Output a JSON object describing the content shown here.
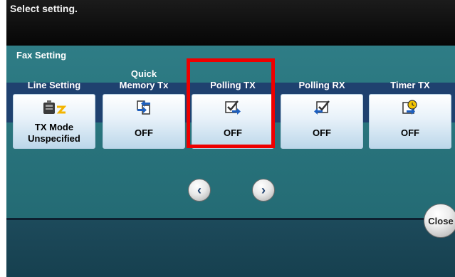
{
  "prompt": "Select setting.",
  "group_title": "Fax Setting",
  "settings": [
    {
      "label": "Line Setting",
      "value": "TX Mode\nUnspecified",
      "icon": "line-setting-icon"
    },
    {
      "label": "Quick\nMemory Tx",
      "value": "OFF",
      "icon": "quick-memory-icon"
    },
    {
      "label": "Polling TX",
      "value": "OFF",
      "icon": "polling-tx-icon",
      "highlighted": true
    },
    {
      "label": "Polling RX",
      "value": "OFF",
      "icon": "polling-rx-icon"
    },
    {
      "label": "Timer TX",
      "value": "OFF",
      "icon": "timer-tx-icon"
    }
  ],
  "nav": {
    "prev_icon": "chevron-left-icon",
    "next_icon": "chevron-right-icon"
  },
  "close_label": "Close",
  "colors": {
    "highlight": "#ee0000",
    "panel": "#2a767f",
    "band": "#1f416f"
  }
}
